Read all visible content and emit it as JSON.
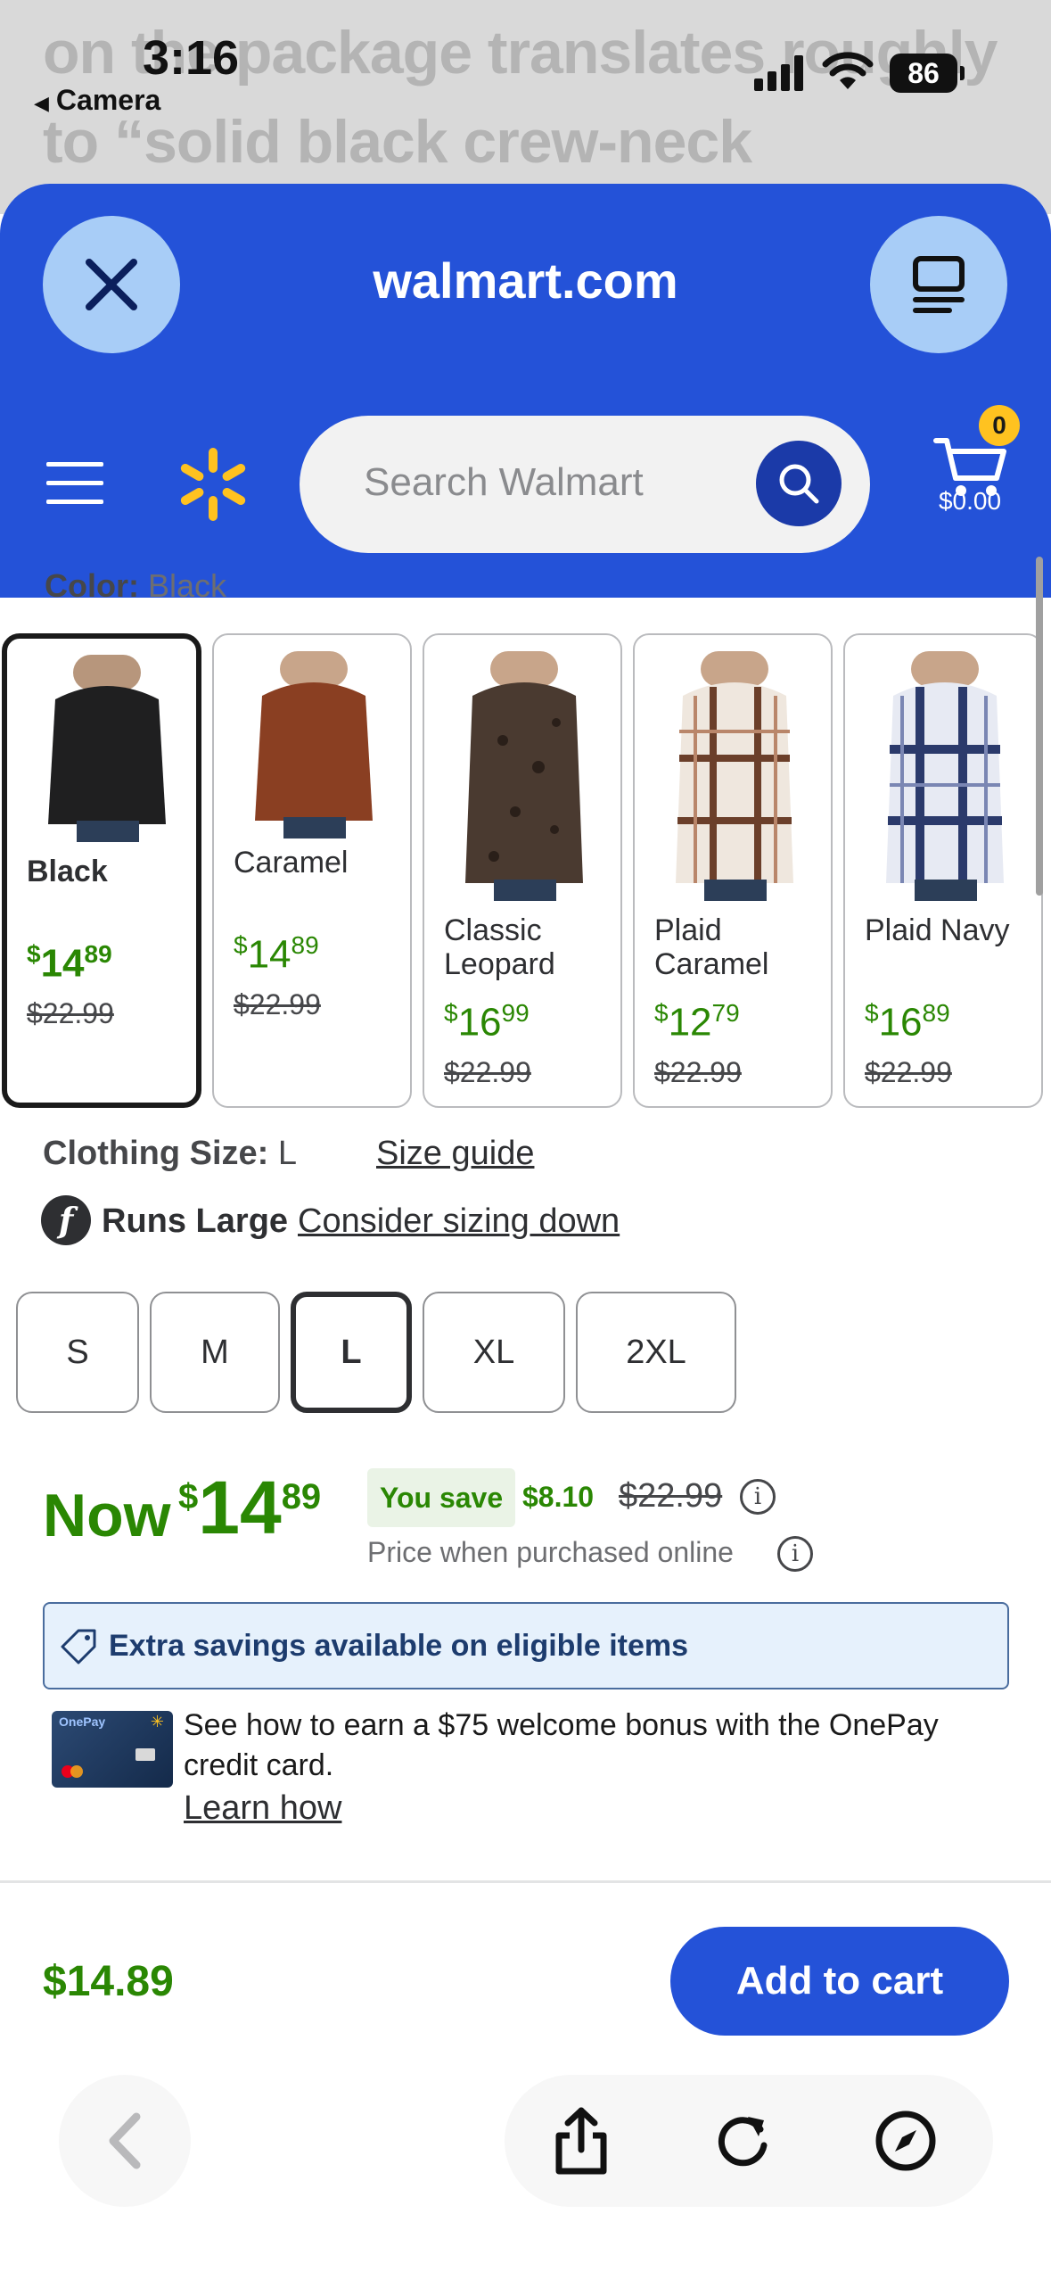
{
  "background": {
    "line1": "on the package translates roughly",
    "line2": "to “solid black crew-neck"
  },
  "status_bar": {
    "time": "3:16",
    "back_app": "Camera",
    "battery": "86"
  },
  "header": {
    "domain": "walmart.com",
    "search_placeholder": "Search Walmart",
    "cart_count": "0",
    "cart_total": "$0.00"
  },
  "colors": {
    "label": "Color:",
    "selected_value": "Black",
    "swatches": [
      {
        "name": "Black",
        "price_currency": "$",
        "price_dollars": "14",
        "price_cents": "89",
        "was": "$22.99",
        "selected": true
      },
      {
        "name": "Caramel",
        "price_currency": "$",
        "price_dollars": "14",
        "price_cents": "89",
        "was": "$22.99",
        "selected": false
      },
      {
        "name": "Classic Leopard",
        "price_currency": "$",
        "price_dollars": "16",
        "price_cents": "99",
        "was": "$22.99",
        "selected": false
      },
      {
        "name": "Plaid Caramel",
        "price_currency": "$",
        "price_dollars": "12",
        "price_cents": "79",
        "was": "$22.99",
        "selected": false
      },
      {
        "name": "Plaid Navy",
        "price_currency": "$",
        "price_dollars": "16",
        "price_cents": "89",
        "was": "$22.99",
        "selected": false
      }
    ]
  },
  "size": {
    "label": "Clothing Size:",
    "value": "L",
    "guide_link": "Size guide",
    "fit_icon": "f",
    "fit_label": "Runs Large",
    "fit_link": "Consider sizing down",
    "options": [
      "S",
      "M",
      "L",
      "XL",
      "2XL"
    ],
    "selected": "L"
  },
  "price": {
    "now_label": "Now",
    "currency": "$",
    "dollars": "14",
    "cents": "89",
    "you_save_label": "You save",
    "save_amount": "$8.10",
    "was": "$22.99",
    "online_note": "Price when purchased online",
    "info_glyph": "i"
  },
  "extra_savings": {
    "text": "Extra savings available on eligible items"
  },
  "onepay": {
    "card_brand": "OnePay",
    "text": "See how to earn a $75 welcome bonus with the OnePay credit card.",
    "link": "Learn how"
  },
  "bottom_bar": {
    "price": "$14.89",
    "add_to_cart": "Add to cart"
  },
  "theme": {
    "walmart_blue": "#2452d8",
    "spark_yellow": "#ffc220",
    "price_green": "#2a8703"
  },
  "icons": [
    "close-icon",
    "reader-mode-icon",
    "menu-icon",
    "walmart-spark-icon",
    "search-icon",
    "cart-icon",
    "tag-icon",
    "info-icon",
    "back-chevron-icon",
    "share-icon",
    "reload-icon",
    "compass-icon"
  ]
}
